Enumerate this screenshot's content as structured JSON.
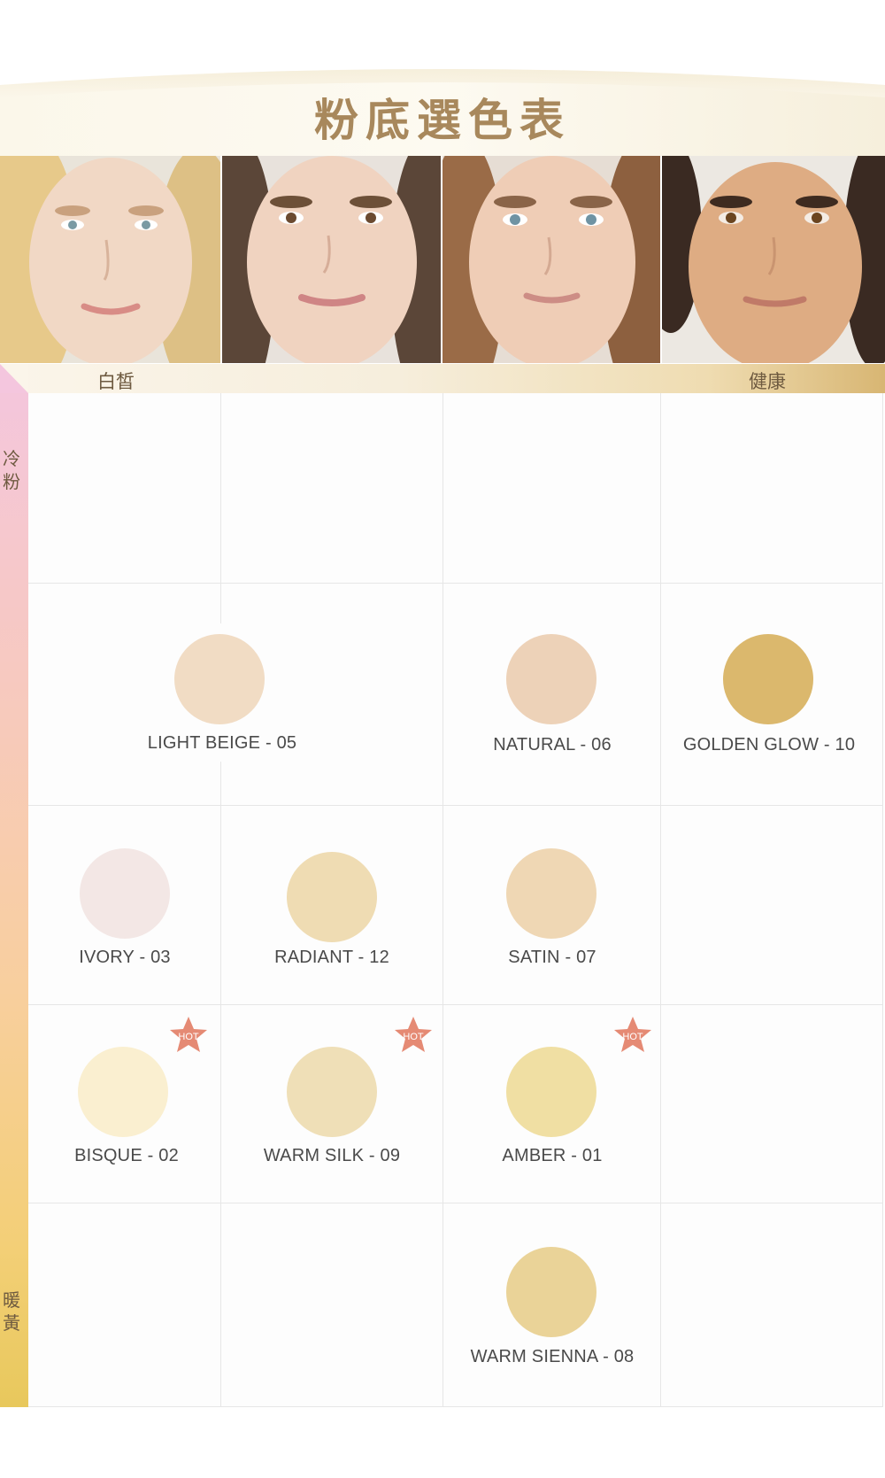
{
  "title": "粉底選色表",
  "tone_axis": {
    "left": "白皙",
    "right": "健康"
  },
  "undertone_axis": {
    "top": "冷粉",
    "bottom": "暖黃"
  },
  "hot_badge": "HOT",
  "shades": [
    {
      "label": "LIGHT BEIGE - 05",
      "color": "#f1dcc4",
      "hot": false
    },
    {
      "label": "NATURAL - 06",
      "color": "#edd2b8",
      "hot": false
    },
    {
      "label": "GOLDEN GLOW - 10",
      "color": "#dbb86d",
      "hot": false
    },
    {
      "label": "IVORY - 03",
      "color": "#f3e7e5",
      "hot": false
    },
    {
      "label": "RADIANT - 12",
      "color": "#efdcb3",
      "hot": false
    },
    {
      "label": "SATIN - 07",
      "color": "#efd7b4",
      "hot": false
    },
    {
      "label": "BISQUE - 02",
      "color": "#faefd0",
      "hot": true
    },
    {
      "label": "WARM SILK - 09",
      "color": "#efdfb7",
      "hot": true
    },
    {
      "label": "AMBER - 01",
      "color": "#f0dfa3",
      "hot": true
    },
    {
      "label": "WARM SIENNA - 08",
      "color": "#ead398",
      "hot": false
    }
  ],
  "colors": {
    "title": "#a8885c",
    "hot_star": "#e58a74",
    "grid_line": "#e6e6e6"
  }
}
